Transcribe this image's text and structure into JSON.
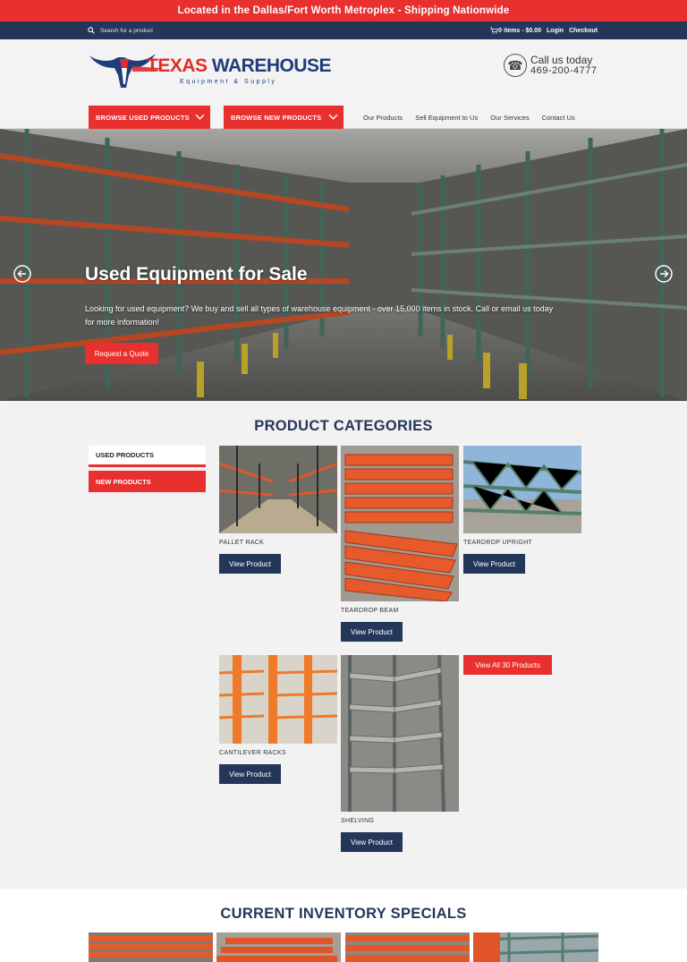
{
  "announcement": "Located in the Dallas/Fort Worth Metroplex - Shipping Nationwide",
  "utility": {
    "search_placeholder": "Search for a product",
    "cart": "0 items - $0.00",
    "login": "Login",
    "checkout": "Checkout"
  },
  "logo": {
    "title_a": "TEXAS",
    "title_b": "WAREHOUSE",
    "subtitle": "Equipment & Supply"
  },
  "contact": {
    "call_label": "Call us today",
    "phone": "469-200-4777"
  },
  "nav": {
    "browse_used": "BROWSE USED PRODUCTS",
    "browse_new": "BROWSE NEW PRODUCTS",
    "links": [
      "Our Products",
      "Sell Equipment to Us",
      "Our Services",
      "Contact Us"
    ]
  },
  "hero": {
    "title": "Used Equipment for Sale",
    "description": "Looking for used equipment? We buy and sell all types of warehouse equipment - over 15,000 items in stock. Call or email us today for more information!",
    "button": "Request a Quote"
  },
  "categories": {
    "title": "PRODUCT CATEGORIES",
    "tabs": [
      "USED PRODUCTS",
      "NEW PRODUCTS"
    ],
    "products": [
      {
        "name": "PALLET RACK",
        "button": "View Product"
      },
      {
        "name": "TEARDROP BEAM",
        "button": "View Product"
      },
      {
        "name": "TEARDROP UPRIGHT",
        "button": "View Product"
      },
      {
        "name": "CANTILEVER RACKS",
        "button": "View Product"
      },
      {
        "name": "SHELVING",
        "button": "View Product"
      }
    ],
    "view_all": "View All 30 Products"
  },
  "specials": {
    "title": "CURRENT INVENTORY SPECIALS"
  },
  "colors": {
    "accent_red": "#e8302e",
    "navy": "#243659",
    "rack_orange": "#e0572a",
    "rack_green": "#4f7c6c"
  }
}
